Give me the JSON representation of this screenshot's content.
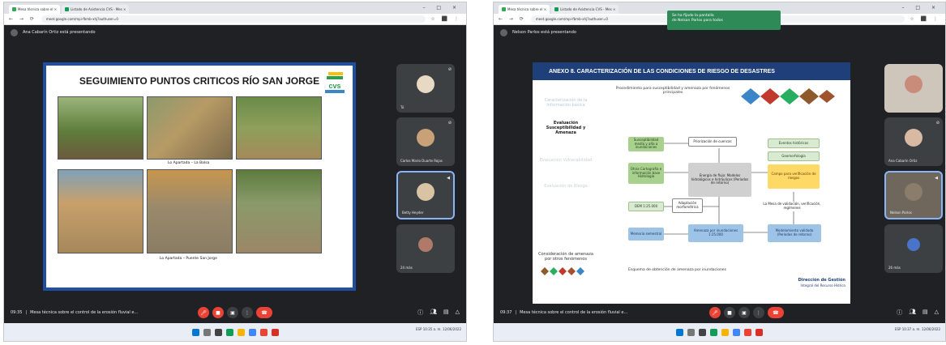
{
  "left": {
    "tabs": [
      "Mesa técnica sobre el  ×",
      "Listado de Asistencia CVS - Mes  ×"
    ],
    "url": "meet.google.com/mpi-fbmb-xhj?authuser=0",
    "presenter_label": "Ana Cabarín Ortiz está presentando",
    "slide": {
      "title": "SEGUIMIENTO PUNTOS CRITICOS RÍO SAN JORGE",
      "logo_text": "cvs",
      "caption_top": "Lo Apartada – La Balsa",
      "caption_bottom": "Lo Apartada – Puente San Jorge"
    },
    "participants": [
      {
        "name": "Tú",
        "color": "#e8d9c4"
      },
      {
        "name": "Carlos Mario Duarte Rojas",
        "color": "#c9a178"
      },
      {
        "name": "Betty Heyder",
        "color": "#d9c3a5"
      },
      {
        "name": "24 más",
        "color": "#b07a6a"
      }
    ],
    "time": "09:35",
    "meeting_title": "Mesa técnica sobre el control de la erosión fluvial e...",
    "tray": "ESP  10:35 a. m.  12/06/2022"
  },
  "right": {
    "tabs": [
      "Mesa técnica sobre el  ×",
      "Listado de Asistencia CVS - Mes  ×"
    ],
    "url": "meet.google.com/mpi-fbmb-xhj?authuser=0",
    "presenter_label": "Nelson Parlos está presentando",
    "notification": {
      "line1": "Se ha fijado la pantalla",
      "line2": "de Nelson Parlos para todos"
    },
    "slide": {
      "title": "ANEXO 8. CARACTERIZACIÓN DE LAS CONDICIONES DE RIESGO DE DESASTRES",
      "subtitle": "Procedimiento para susceptibilidad y amenaza por fenómenos principales",
      "left_steps": [
        "Caracterización de la información básica",
        "Evaluación Susceptibilidad y Amenaza",
        "Evaluación Vulnerabilidad",
        "Evaluación de Riesgo"
      ],
      "left_bottom": "Consideración de amenaza por otros fenómenos",
      "boxes": {
        "susceptibilidad": "Susceptibilidad media y alta a inundaciones",
        "priorizacion": "Priorización de cuencas",
        "cartografia": "Otras Cartografía e información base Hidrología",
        "energia": "Energía de flujo: Modelos hidrológicos e hidráulicos (Periodos de retorno)",
        "eventos": "Eventos históricos",
        "geomorfologia": "Geomorfología",
        "campo": "Campo para verificación de riesgos",
        "dem": "DEM 1:25.000",
        "adaptacion": "Adaptación morfométrica",
        "mapa_amenaza": "Amenaza por inundaciones 1:25.000",
        "validacion": "Modelamiento validado (Periodos de retorno)",
        "memoria": "Memoria semestral",
        "factores": "La Mesa de validación, verificación, regímenes"
      },
      "footer_left": "Esquema de obtención de amenaza por inundaciones",
      "footer_right_title": "Dirección de Gestión",
      "footer_right_sub": "Integral del Recurso Hídrico"
    },
    "participants": [
      {
        "name": "",
        "color": "#c98b7a"
      },
      {
        "name": "Ana Cabarín Ortiz",
        "color": "#d8b9a4"
      },
      {
        "name": "Nelson Parlos",
        "color": "#8b7d6b"
      },
      {
        "name": "26 más",
        "color": "#4a74c9"
      }
    ],
    "time": "09:37",
    "meeting_title": "Mesa técnica sobre el control de la erosión fluvial e...",
    "tray": "ESP  10:37 a. m.  12/06/2022"
  },
  "colors": {
    "meet_bg": "#202124",
    "slide_border": "#1f4fa3",
    "end_call": "#ea4335"
  }
}
